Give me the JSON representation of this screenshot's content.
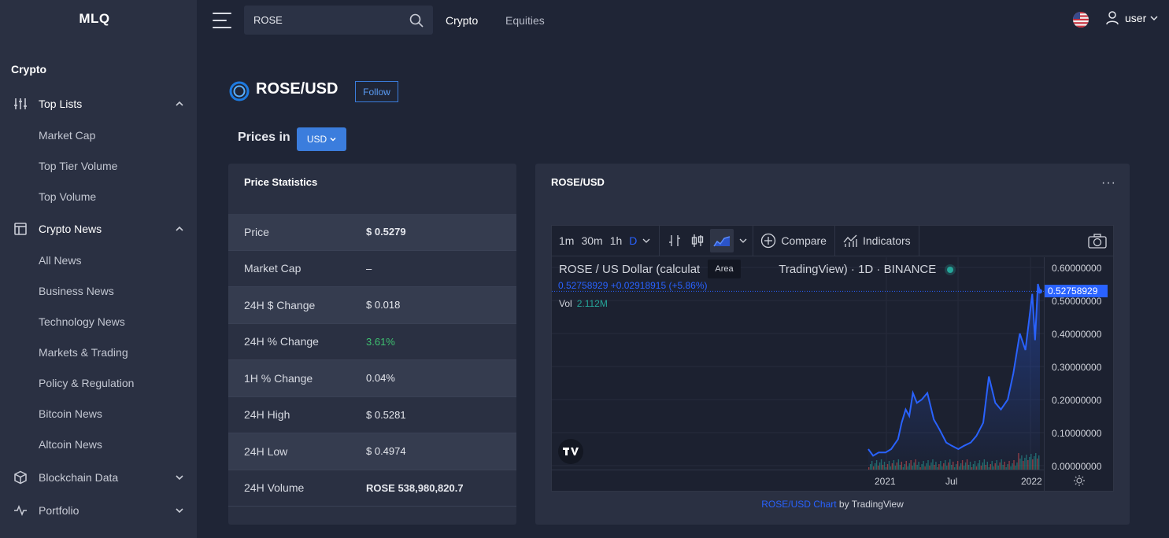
{
  "app": {
    "logo": "MLQ"
  },
  "sidebar": {
    "section": "Crypto",
    "groups": [
      {
        "label": "Top Lists",
        "icon": "sliders-icon",
        "expanded": true,
        "items": [
          "Market Cap",
          "Top Tier Volume",
          "Top Volume"
        ]
      },
      {
        "label": "Crypto News",
        "icon": "newspaper-icon",
        "expanded": true,
        "items": [
          "All News",
          "Business News",
          "Technology News",
          "Markets & Trading",
          "Policy & Regulation",
          "Bitcoin News",
          "Altcoin News"
        ]
      },
      {
        "label": "Blockchain Data",
        "icon": "cube-icon",
        "expanded": false,
        "items": []
      },
      {
        "label": "Portfolio",
        "icon": "activity-icon",
        "expanded": false,
        "items": []
      }
    ]
  },
  "header": {
    "search_value": "ROSE",
    "nav": [
      "Crypto",
      "Equities"
    ],
    "user_label": "user"
  },
  "pair": {
    "title": "ROSE/USD",
    "follow_label": "Follow",
    "prices_in_label": "Prices in",
    "currency": "USD"
  },
  "stats": {
    "title": "Price Statistics",
    "rows": [
      {
        "label": "Price",
        "value": "$ 0.5279"
      },
      {
        "label": "Market Cap",
        "value": "–"
      },
      {
        "label": "24H $ Change",
        "value": "$ 0.018"
      },
      {
        "label": "24H % Change",
        "value": "3.61%"
      },
      {
        "label": "1H % Change",
        "value": "0.04%"
      },
      {
        "label": "24H High",
        "value": "$ 0.5281"
      },
      {
        "label": "24H Low",
        "value": "$ 0.4974"
      },
      {
        "label": "24H Volume",
        "value": "ROSE 538,980,820.7"
      }
    ]
  },
  "chart_card": {
    "title": "ROSE/USD",
    "more_label": "···",
    "timeframes": [
      "1m",
      "30m",
      "1h",
      "D"
    ],
    "active_timeframe": "D",
    "compare_label": "Compare",
    "indicators_label": "Indicators",
    "tooltip": "Area",
    "legend_left": "ROSE / US Dollar (calculat",
    "legend_right": "TradingView) · 1D · BINANCE",
    "legend_values": "0.52758929  +0.02918915 (+5.86%)",
    "vol_label": "Vol",
    "vol_value": "2.112M",
    "attribution_link": "ROSE/USD Chart",
    "attribution_rest": " by TradingView",
    "colors": {
      "line": "#2962ff",
      "up": "#26a69a",
      "down": "#ef5350"
    }
  },
  "chart_data": {
    "type": "area",
    "title": "ROSE / US Dollar",
    "x_ticks": [
      "2021",
      "Jul",
      "2022"
    ],
    "y_ticks": [
      "0.60000000",
      "0.50000000",
      "0.40000000",
      "0.30000000",
      "0.20000000",
      "0.10000000",
      "0.00000000"
    ],
    "ylim": [
      0,
      0.6
    ],
    "last_value": "0.52758929",
    "x": [
      "2020-11-19",
      "2020-12-01",
      "2020-12-15",
      "2021-01-01",
      "2021-01-15",
      "2021-02-01",
      "2021-02-10",
      "2021-02-20",
      "2021-03-01",
      "2021-03-10",
      "2021-03-20",
      "2021-04-01",
      "2021-04-15",
      "2021-05-01",
      "2021-05-15",
      "2021-06-01",
      "2021-06-15",
      "2021-07-01",
      "2021-07-15",
      "2021-08-01",
      "2021-08-15",
      "2021-09-01",
      "2021-09-15",
      "2021-10-01",
      "2021-10-15",
      "2021-11-01",
      "2021-11-15",
      "2021-12-01",
      "2021-12-15",
      "2022-01-01",
      "2022-01-08",
      "2022-01-15",
      "2022-01-20"
    ],
    "values": [
      0.05,
      0.03,
      0.04,
      0.04,
      0.05,
      0.08,
      0.13,
      0.17,
      0.15,
      0.22,
      0.19,
      0.2,
      0.22,
      0.14,
      0.11,
      0.07,
      0.06,
      0.05,
      0.06,
      0.07,
      0.09,
      0.13,
      0.27,
      0.19,
      0.17,
      0.2,
      0.28,
      0.4,
      0.35,
      0.52,
      0.38,
      0.55,
      0.5276
    ]
  }
}
